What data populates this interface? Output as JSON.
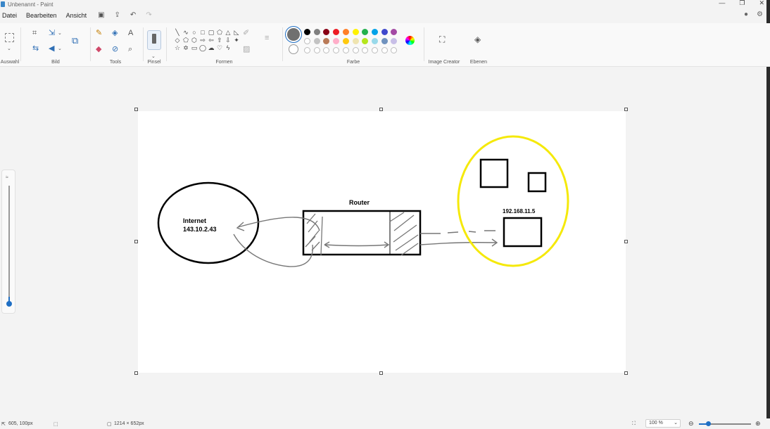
{
  "window": {
    "title": "Unbenannt - Paint"
  },
  "menu": {
    "file": "Datei",
    "edit": "Bearbeiten",
    "view": "Ansicht"
  },
  "ribbon": {
    "groups": {
      "selection": "Auswahl",
      "image": "Bild",
      "tools": "Tools",
      "brushes": "Pinsel",
      "shapes": "Formen",
      "colors": "Farbe",
      "image_creator": "Image Creator",
      "layers": "Ebenen"
    },
    "palette_row1": [
      "#000000",
      "#7f7f7f",
      "#880015",
      "#ed1c24",
      "#ff7f27",
      "#fff200",
      "#22b14c",
      "#00a2e8",
      "#3f48cc",
      "#a349a4"
    ],
    "palette_row2": [
      "#ffffff",
      "#c3c3c3",
      "#b97a57",
      "#ffaec9",
      "#ffc90e",
      "#efe4b0",
      "#b5e61d",
      "#99d9ea",
      "#7092be",
      "#c8bfe7"
    ],
    "current_color": "#707070"
  },
  "drawing": {
    "internet_title": "Internet",
    "internet_ip": "143.10.2.43",
    "router_label": "Router",
    "client_ip": "192.168.11.5"
  },
  "status": {
    "cursor_pos": "605, 100px",
    "canvas_size": "1214 × 652px",
    "zoom": "100 %"
  }
}
